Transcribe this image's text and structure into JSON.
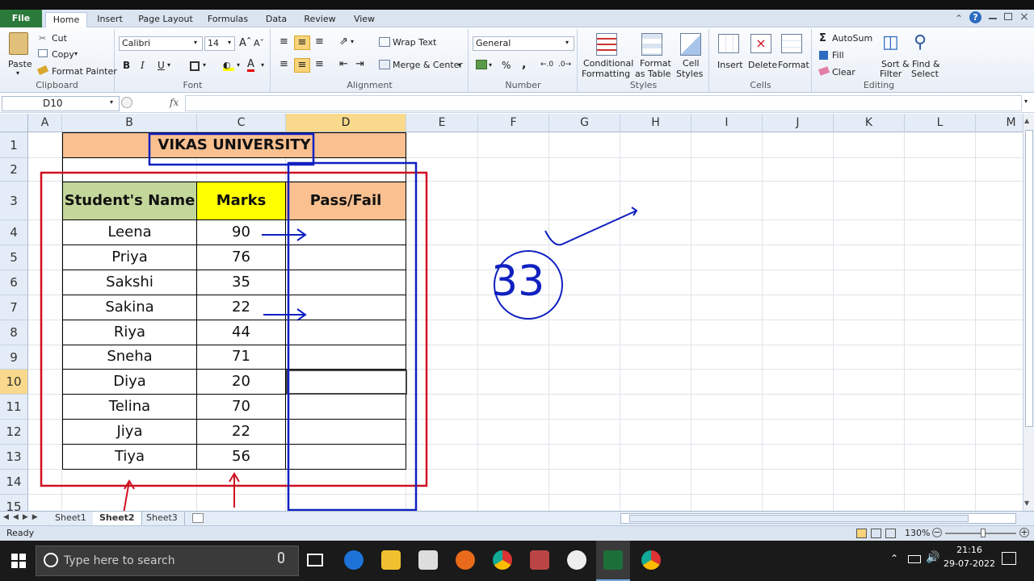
{
  "ribbon_tabs": [
    "File",
    "Home",
    "Insert",
    "Page Layout",
    "Formulas",
    "Data",
    "Review",
    "View"
  ],
  "clipboard": {
    "paste": "Paste",
    "cut": "Cut",
    "copy": "Copy",
    "format_painter": "Format Painter",
    "label": "Clipboard"
  },
  "font": {
    "name": "Calibri",
    "size": "14",
    "label": "Font",
    "bold": "B",
    "italic": "I",
    "underline": "U"
  },
  "alignment": {
    "wrap": "Wrap Text",
    "merge": "Merge & Center",
    "label": "Alignment"
  },
  "number": {
    "format": "General",
    "label": "Number",
    "percent": "%",
    "comma": ","
  },
  "styles": {
    "conditional1": "Conditional",
    "conditional2": "Formatting",
    "table1": "Format",
    "table2": "as Table",
    "cell1": "Cell",
    "cell2": "Styles",
    "label": "Styles"
  },
  "cells": {
    "insert": "Insert",
    "delete": "Delete",
    "format": "Format",
    "label": "Cells"
  },
  "editing": {
    "autosum": "AutoSum",
    "fill": "Fill",
    "clear": "Clear",
    "sort1": "Sort &",
    "sort2": "Filter",
    "find1": "Find &",
    "find2": "Select",
    "label": "Editing"
  },
  "namebox": "D10",
  "fx": "fx",
  "columns": [
    "A",
    "B",
    "C",
    "D",
    "E",
    "F",
    "G",
    "H",
    "I",
    "J",
    "K",
    "L",
    "M"
  ],
  "rows": [
    "1",
    "2",
    "3",
    "4",
    "5",
    "6",
    "7",
    "8",
    "9",
    "10",
    "11",
    "12",
    "13",
    "14",
    "15"
  ],
  "sheet": {
    "title": "VIKAS UNIVERSITY",
    "headers": [
      "Student's Name",
      "Marks",
      "Pass/Fail"
    ],
    "students": [
      {
        "name": "Leena",
        "marks": "90"
      },
      {
        "name": "Priya",
        "marks": "76"
      },
      {
        "name": "Sakshi",
        "marks": "35"
      },
      {
        "name": "Sakina",
        "marks": "22"
      },
      {
        "name": "Riya",
        "marks": "44"
      },
      {
        "name": "Sneha",
        "marks": "71"
      },
      {
        "name": "Diya",
        "marks": "20"
      },
      {
        "name": "Telina",
        "marks": "70"
      },
      {
        "name": "Jiya",
        "marks": "22"
      },
      {
        "name": "Tiya",
        "marks": "56"
      }
    ]
  },
  "annotation_number": "33",
  "sheet_tabs": [
    "Sheet1",
    "Sheet2",
    "Sheet3"
  ],
  "status": {
    "ready": "Ready",
    "zoom": "130%"
  },
  "taskbar": {
    "search_placeholder": "Type here to search",
    "time": "21:16",
    "date": "29-07-2022"
  },
  "colors": {
    "header_green": "#c4d79b",
    "header_yellow": "#ffff00",
    "header_orange": "#fac090",
    "title_orange": "#fac090",
    "annot_blue": "#1020c0",
    "annot_red": "#d01020",
    "file_green": "#2a7a3b"
  }
}
